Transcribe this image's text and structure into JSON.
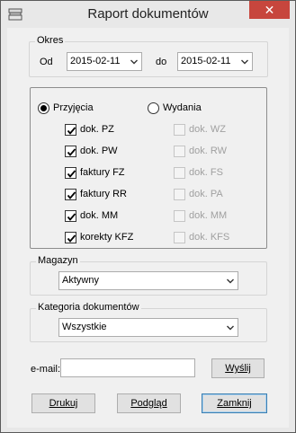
{
  "window": {
    "title": "Raport dokumentów",
    "close_glyph": "✕",
    "icon": "app-icon"
  },
  "period": {
    "legend": "Okres",
    "from_label": "Od",
    "from_value": "2015-02-11",
    "to_label": "do",
    "to_value": "2015-02-11"
  },
  "documents": {
    "incoming": {
      "label": "Przyjęcia",
      "selected": true,
      "items": [
        {
          "label": "dok. PZ",
          "checked": true
        },
        {
          "label": "dok. PW",
          "checked": true
        },
        {
          "label": "faktury FZ",
          "checked": true
        },
        {
          "label": "faktury RR",
          "checked": true
        },
        {
          "label": "dok. MM",
          "checked": true
        },
        {
          "label": "korekty KFZ",
          "checked": true
        }
      ]
    },
    "outgoing": {
      "label": "Wydania",
      "selected": false,
      "items": [
        {
          "label": "dok. WZ",
          "checked": false
        },
        {
          "label": "dok. RW",
          "checked": false
        },
        {
          "label": "dok. FS",
          "checked": false
        },
        {
          "label": "dok. PA",
          "checked": false
        },
        {
          "label": "dok. MM",
          "checked": false
        },
        {
          "label": "dok. KFS",
          "checked": false
        }
      ]
    }
  },
  "warehouse": {
    "legend": "Magazyn",
    "value": "Aktywny"
  },
  "category": {
    "legend": "Kategoria dokumentów",
    "value": "Wszystkie"
  },
  "email": {
    "label": "e-mail:",
    "value": "",
    "send_label": "Wyślij"
  },
  "buttons": {
    "print": "Drukuj",
    "preview": "Podgląd",
    "close": "Zamknij"
  },
  "colors": {
    "close_red": "#c7463d",
    "focus_border": "#3c7fb1"
  }
}
